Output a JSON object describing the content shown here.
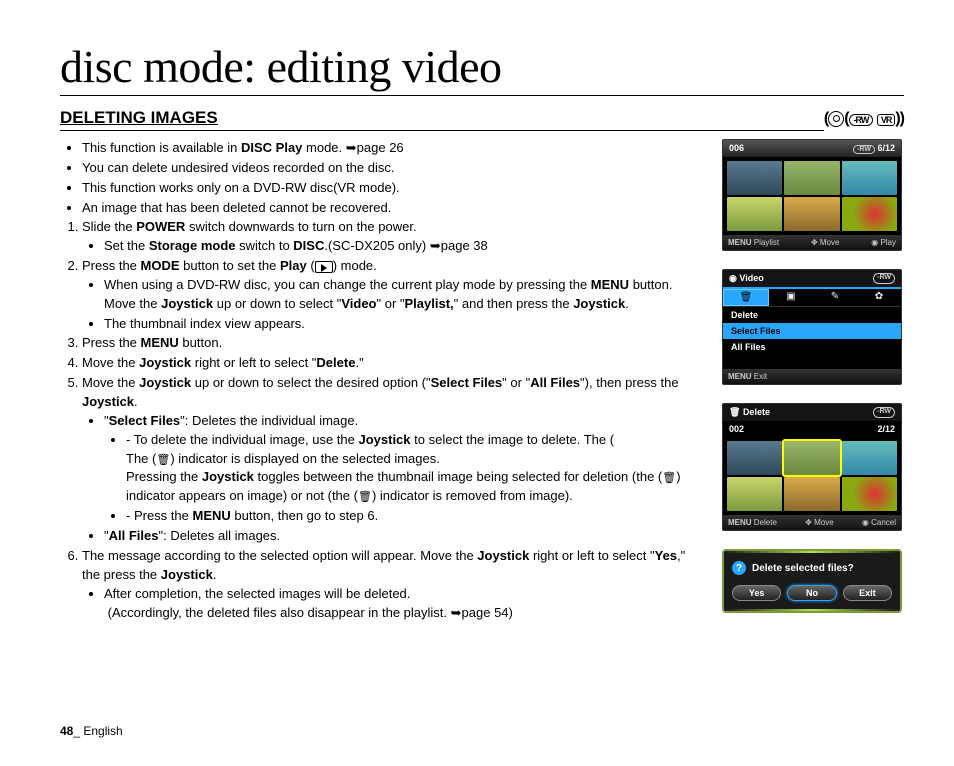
{
  "title": "disc mode: editing video",
  "section": "DELETING IMAGES",
  "mode_badge": {
    "rw": "-RW",
    "vr": "VR"
  },
  "bullets_intro": [
    {
      "pre": "This function is available in ",
      "b": "DISC Play",
      "post": " mode. ",
      "arrow": "➥",
      "ref": "page 26"
    },
    {
      "text": "You can delete undesired videos recorded on the disc."
    },
    {
      "text": "This function works only on a DVD-RW disc(VR mode)."
    },
    {
      "text": "An image that has been deleted cannot be recovered."
    }
  ],
  "steps": {
    "s1": {
      "pre": "Slide the ",
      "b": "POWER",
      "post": " switch downwards to turn on the power.",
      "sub": {
        "pre": "Set the ",
        "b": "Storage mode",
        "post": " switch to ",
        "b2": "DISC",
        "post2": ".(SC-DX205 only) ",
        "arrow": "➥",
        "ref": "page 38"
      }
    },
    "s2": {
      "pre": "Press the ",
      "b": "MODE",
      "post": " button to set the ",
      "b2": "Play",
      "post2": " (",
      "post3": ") mode.",
      "sub1": {
        "pre": "When using a DVD-RW disc, you can change the current play mode by pressing the ",
        "b": "MENU",
        "post": " button. Move the ",
        "b2": "Joystick",
        "post2": " up or down to select \"",
        "b3": "Video",
        "post3": "\" or \"",
        "b4": "Playlist,",
        "post4": "\" and then press the ",
        "b5": "Joystick",
        "post5": "."
      },
      "sub2": "The thumbnail index view appears."
    },
    "s3": {
      "pre": "Press the ",
      "b": "MENU",
      "post": " button."
    },
    "s4": {
      "pre": "Move the ",
      "b": "Joystick",
      "post": " right or left to select \"",
      "b2": "Delete",
      "post2": ".\""
    },
    "s5": {
      "pre": "Move the ",
      "b": "Joystick",
      "post": " up or down to select the desired option (\"",
      "b2": "Select Files",
      "post2": "\" or \"",
      "b3": "All Files",
      "post3": "\"), then press the ",
      "b4": "Joystick",
      "post4": ".",
      "sf_label": "Select Files",
      "sf_desc": "\": Deletes the individual image.",
      "d1": {
        "pre": "To delete the individual image, use the ",
        "b": "Joystick",
        "post": " to select the image to delete. The (",
        "post2": ") indicator is displayed on the selected images.",
        "line2a": "Pressing the ",
        "b2": "Joystick",
        "line2b": " toggles between the thumbnail image being selected for deletion (the (",
        "line2c": ") indicator appears on image) or not (the (",
        "line2d": ") indicator is removed from image)."
      },
      "d2": {
        "pre": "Press the ",
        "b": "MENU",
        "post": " button, then go to step 6."
      },
      "af_label": "All Files",
      "af_desc": "\": Deletes all images."
    },
    "s6": {
      "pre": "The message according to the selected option will appear. Move the ",
      "b": "Joystick",
      "post": " right or left to select \"",
      "b2": "Yes",
      "post2": ",\" the press the ",
      "b3": "Joystick",
      "post3": ".",
      "sub": {
        "text": "After completion, the selected images will be deleted.",
        "note": "(Accordingly, the deleted files also disappear in the playlist. ",
        "arrow": "➥",
        "ref": "page 54)"
      }
    }
  },
  "fig1": {
    "id": "006",
    "count": "6/12",
    "foot": {
      "menu": "MENU",
      "l": "Playlist",
      "m": "Move",
      "r": "Play"
    }
  },
  "fig2": {
    "title": "Video",
    "badge": "-RW",
    "items": [
      "Delete",
      "Select Files",
      "All Files"
    ],
    "selected": 1,
    "foot": {
      "menu": "MENU",
      "l": "Exit"
    }
  },
  "fig3": {
    "title": "Delete",
    "badge": "-RW",
    "id": "002",
    "count": "2/12",
    "foot": {
      "menu": "MENU",
      "l": "Delete",
      "m": "Move",
      "r": "Cancel"
    }
  },
  "confirm": {
    "q": "Delete selected files?",
    "yes": "Yes",
    "no": "No",
    "exit": "Exit"
  },
  "footer": {
    "page": "48",
    "sep": "_ ",
    "lang": "English"
  }
}
